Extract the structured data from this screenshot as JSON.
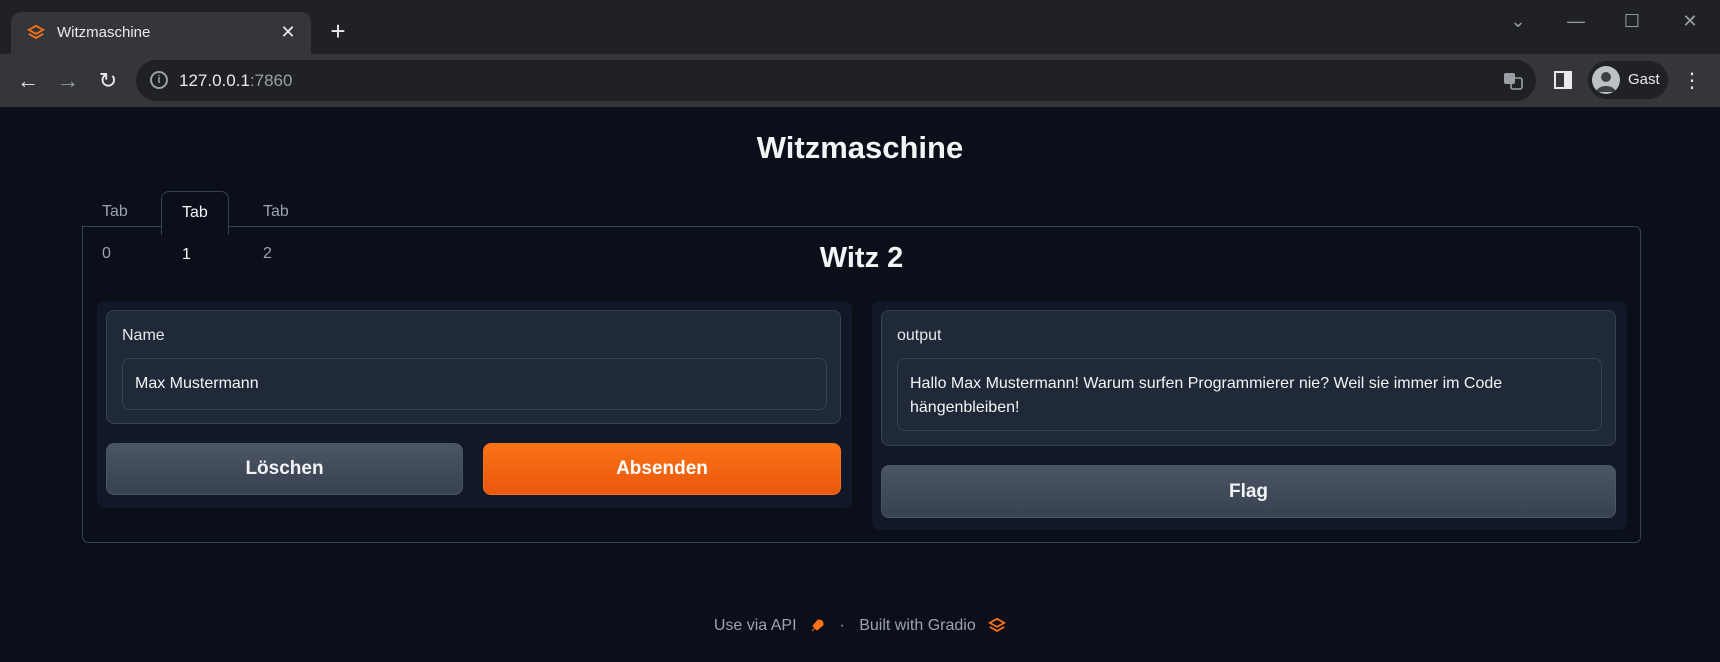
{
  "browser": {
    "tab_title": "Witzmaschine",
    "new_tab": "+",
    "url_host": "127.0.0.1",
    "url_port": ":7860",
    "profile_label": "Gast"
  },
  "app": {
    "title": "Witzmaschine",
    "tabs": [
      {
        "label": "Tab 0"
      },
      {
        "label": "Tab 1"
      },
      {
        "label": "Tab 2"
      }
    ],
    "active_tab": "Tab 1",
    "panel_heading": "Witz 2",
    "input": {
      "label": "Name",
      "value": "Max Mustermann"
    },
    "buttons": {
      "clear": "Löschen",
      "submit": "Absenden",
      "flag": "Flag"
    },
    "output": {
      "label": "output",
      "value": "Hallo Max Mustermann! Warum surfen Programmierer nie? Weil sie immer im Code hängenbleiben!"
    }
  },
  "footer": {
    "api_link": "Use via API",
    "separator": "·",
    "built_with": "Built with Gradio"
  },
  "colors": {
    "accent": "#f97316",
    "background": "#0b0f19"
  },
  "icons": {
    "favicon": "gradio-logo-icon",
    "api": "rocket-icon",
    "gradio": "gradio-logo-icon"
  }
}
